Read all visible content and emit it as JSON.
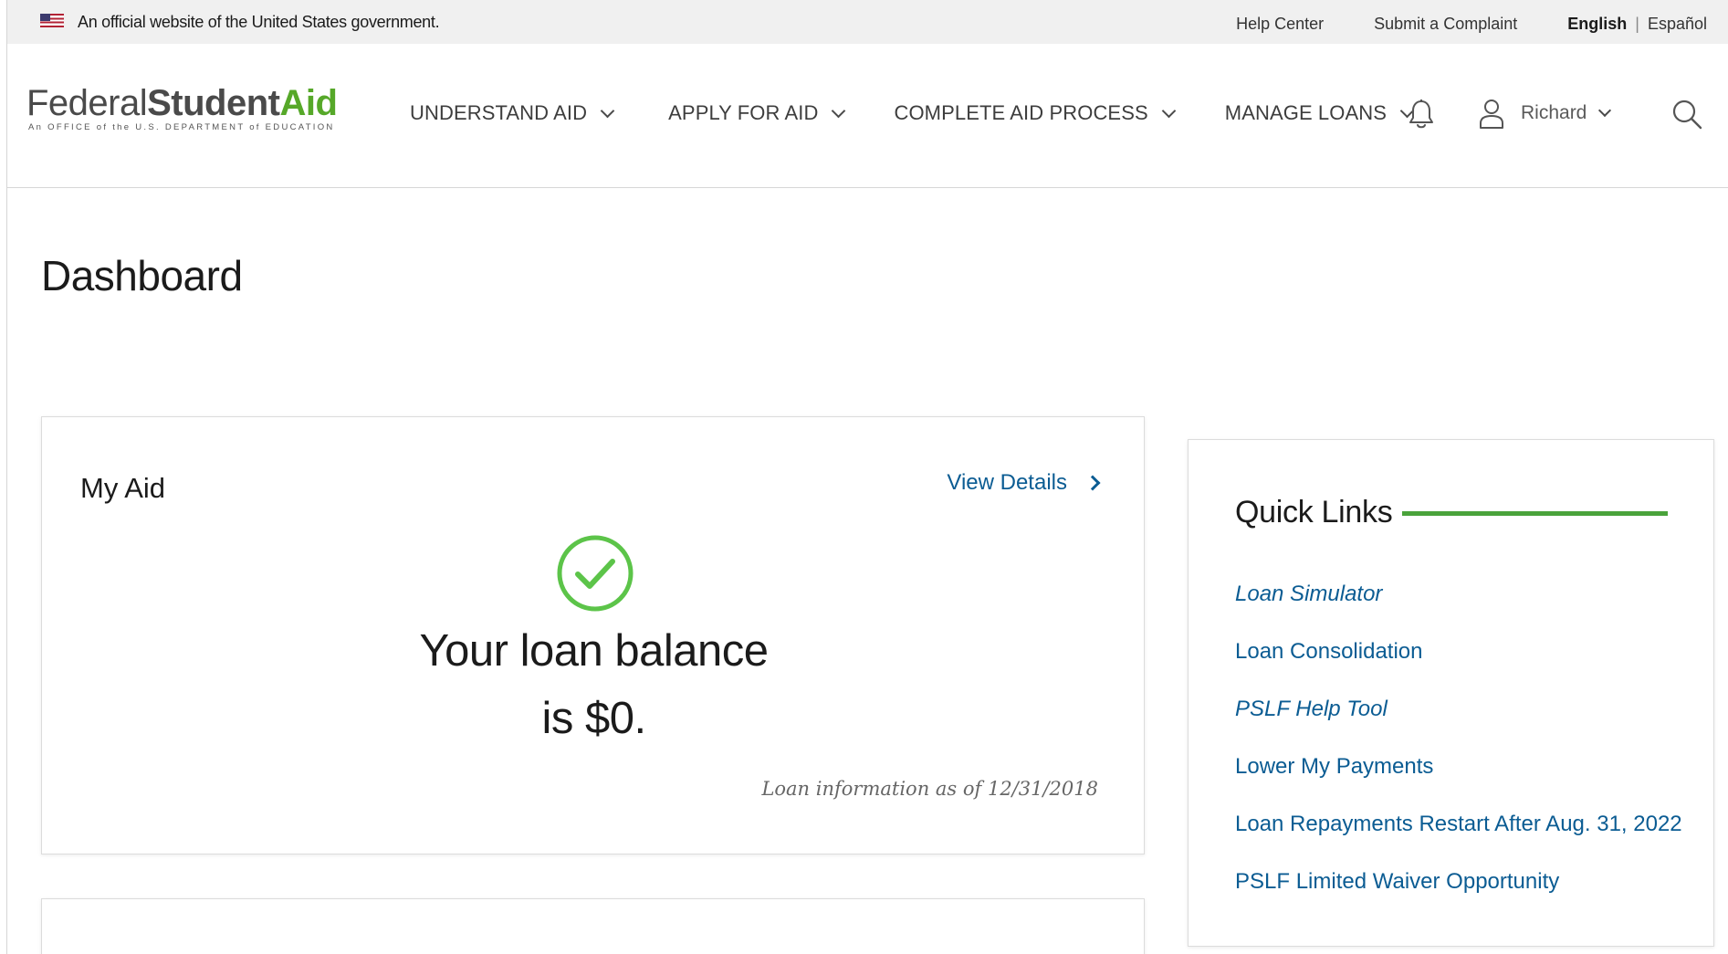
{
  "gov_banner": {
    "text": "An official website of the United States government.",
    "links": {
      "help_center": "Help Center",
      "submit_complaint": "Submit a Complaint",
      "english": "English",
      "separator": "|",
      "espanol": "Español"
    }
  },
  "header": {
    "logo": {
      "federal": "Federal",
      "student": "Student",
      "aid": "Aid",
      "subtitle": "An OFFICE of the U.S. DEPARTMENT of EDUCATION"
    },
    "nav": [
      {
        "label": "UNDERSTAND AID"
      },
      {
        "label": "APPLY FOR AID"
      },
      {
        "label": "COMPLETE AID PROCESS"
      },
      {
        "label": "MANAGE LOANS"
      }
    ],
    "user": {
      "name": "Richard"
    },
    "icons": [
      "bell-icon",
      "user-icon",
      "chevron-down-icon",
      "search-icon"
    ]
  },
  "page": {
    "title": "Dashboard"
  },
  "my_aid": {
    "title": "My Aid",
    "view_details": "View Details",
    "balance_line1": "Your loan balance",
    "balance_line2": "is $0.",
    "loan_info": "Loan information as of 12/31/2018"
  },
  "quick_links": {
    "title": "Quick Links",
    "items": [
      {
        "label": "Loan Simulator"
      },
      {
        "label": "Loan Consolidation"
      },
      {
        "label": "PSLF Help Tool"
      },
      {
        "label": "Lower My Payments"
      },
      {
        "label": "Loan Repayments Restart After Aug. 31, 2022"
      },
      {
        "label": "PSLF Limited Waiver Opportunity"
      }
    ]
  },
  "colors": {
    "brand_green": "#56a829",
    "link_blue": "#0b5c93",
    "check_green": "#5cc449",
    "banner_bg": "#f0f0f0"
  }
}
